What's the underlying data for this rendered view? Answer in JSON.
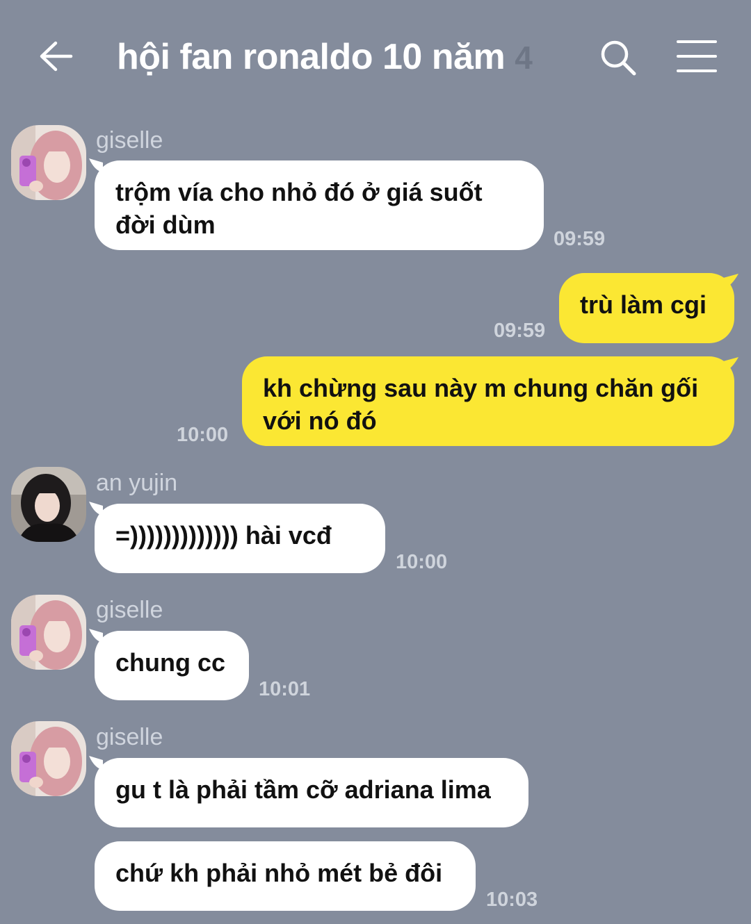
{
  "header": {
    "title": "hội fan ronaldo 10 năm",
    "member_count": "4",
    "icons": {
      "back": "back-arrow-icon",
      "search": "search-icon",
      "menu": "menu-icon"
    }
  },
  "colors": {
    "background": "#848c9c",
    "incoming_bubble": "#ffffff",
    "outgoing_bubble": "#fbe733",
    "timestamp": "#cfd4dc"
  },
  "messages": [
    {
      "sender": "giselle",
      "text": "trộm vía cho nhỏ đó ở giá suốt đời dùm",
      "time": "09:59",
      "direction": "incoming"
    },
    {
      "sender": "",
      "text": "trù làm cgi",
      "time": "09:59",
      "direction": "outgoing"
    },
    {
      "sender": "",
      "text": "kh chừng sau này m chung chăn gối với nó đó",
      "time": "10:00",
      "direction": "outgoing"
    },
    {
      "sender": "an yujin",
      "text": "=))))))))))))) hài vcđ",
      "time": "10:00",
      "direction": "incoming"
    },
    {
      "sender": "giselle",
      "text": "chung cc",
      "time": "10:01",
      "direction": "incoming"
    },
    {
      "sender": "giselle",
      "text": "gu t là phải tầm cỡ adriana lima",
      "time": "",
      "direction": "incoming"
    },
    {
      "sender": "",
      "text": "chứ kh phải nhỏ mét bẻ đôi",
      "time": "10:03",
      "direction": "incoming"
    }
  ]
}
